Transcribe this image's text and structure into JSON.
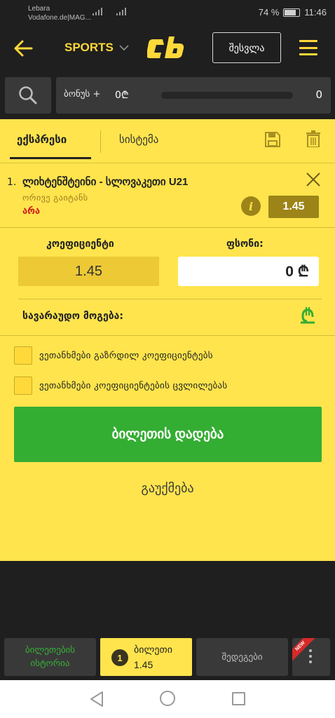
{
  "status_bar": {
    "carrier_line1": "Lebara",
    "carrier_line2": "Vodafone.de|MAG...",
    "battery": "74 %",
    "time": "11:46"
  },
  "header": {
    "sport_selector": "SPORTS",
    "logo_text": "Cb",
    "login_label": "შესვლა"
  },
  "bonus": {
    "label": "ბონუს +",
    "amount": "0₾",
    "count": "0"
  },
  "betslip": {
    "tabs": [
      {
        "label": "ექსპრესი",
        "active": true
      },
      {
        "label": "სისტემა",
        "active": false
      }
    ],
    "event": {
      "number": "1.",
      "title": "ლიხტენშტეინი - სლოვაკეთი U21",
      "market": "ორივე გაიტანს",
      "outcome": "არა",
      "odd": "1.45"
    },
    "coef_label": "კოეფიციენტი",
    "coef_value": "1.45",
    "stake_label": "ფსონი:",
    "stake_value": "0 ₾",
    "possible_win_label": "სავარაუდო მოგება:",
    "options": [
      {
        "label": "ვეთანხმები გაზრდილ კოეფიციენტებს",
        "checked": false
      },
      {
        "label": "ვეთანხმები კოეფიციენტების ცვლილებას",
        "checked": false
      }
    ],
    "place_bet_label": "ბილეთის დადება",
    "cancel_label": "გაუქმება"
  },
  "bottom_bar": {
    "history_label": "ბილეთების ისტორია",
    "ticket_count": "1",
    "ticket_label": "ბილეთი",
    "ticket_odd": "1.45",
    "results_label": "შედეგები",
    "new_badge": "NEW"
  },
  "colors": {
    "accent_yellow": "#ffe44d",
    "brand_yellow": "#ffd83a",
    "dark_bg": "#1f1f1f",
    "green": "#34ad33",
    "outcome_red": "#d21a1a"
  },
  "icons": [
    "back-arrow-icon",
    "chevron-down-icon",
    "menu-icon",
    "search-icon",
    "save-icon",
    "trash-icon",
    "close-icon",
    "info-icon",
    "lari-icon",
    "more-dots-icon"
  ]
}
